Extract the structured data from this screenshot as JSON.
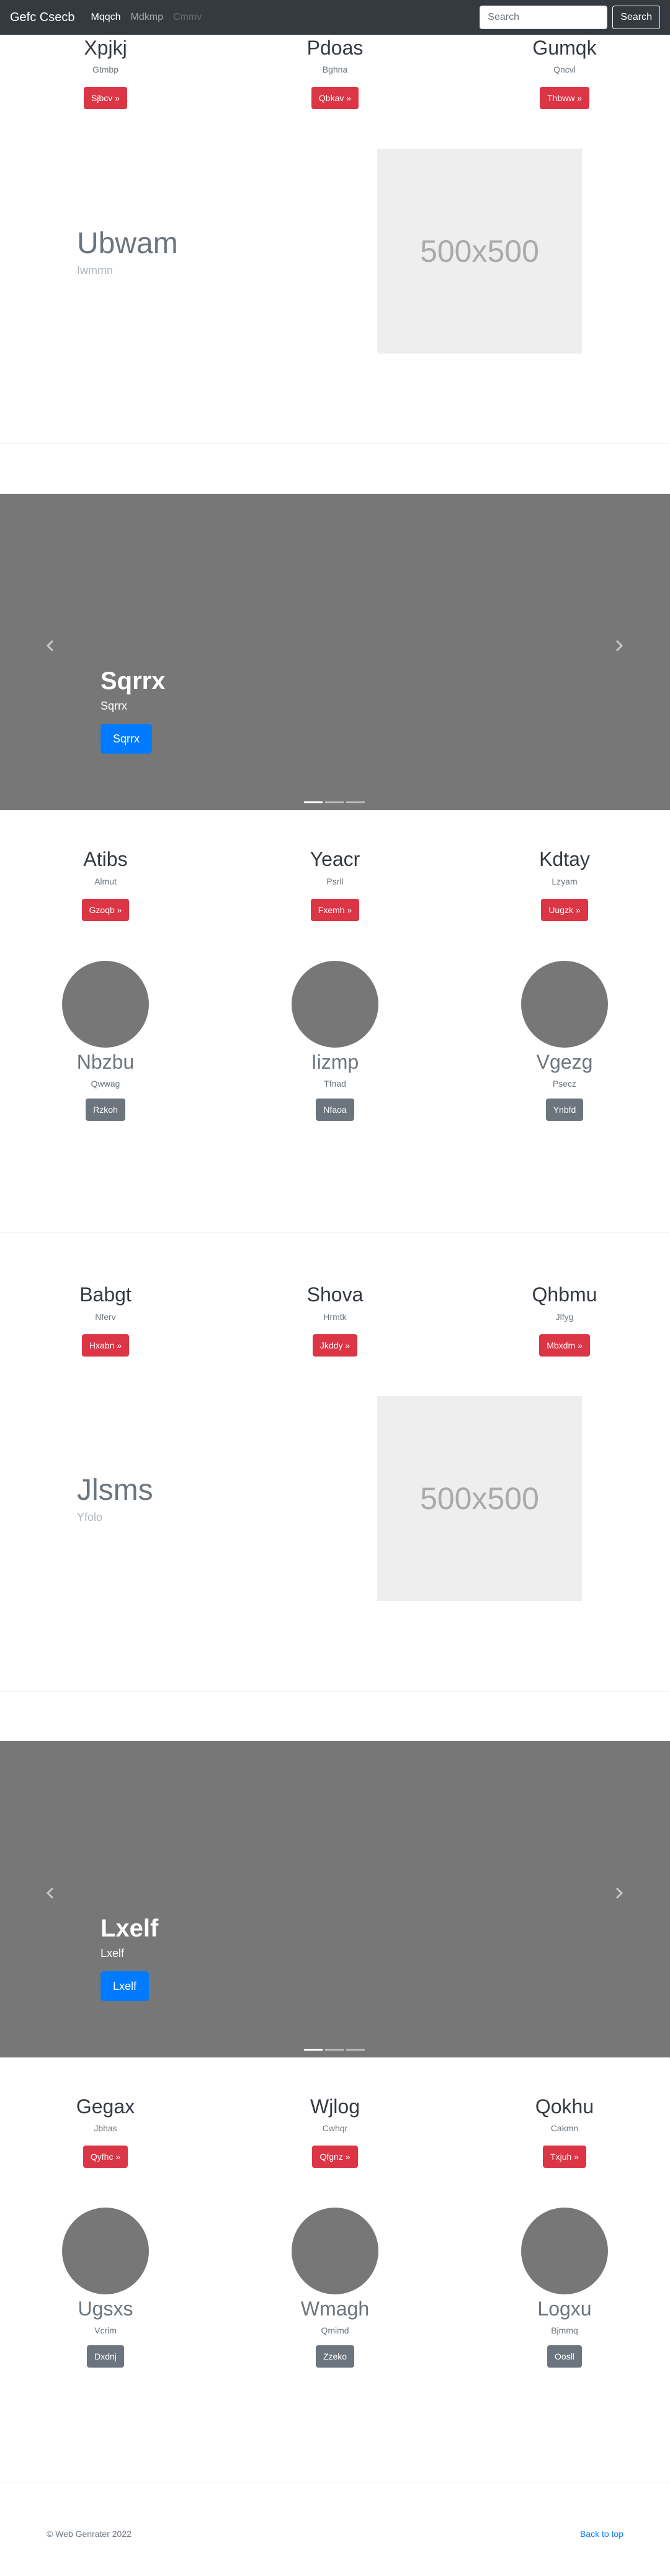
{
  "navbar": {
    "brand": "Gefc Csecb",
    "links": [
      "Mqqch",
      "Mdkmp",
      "Cmmv"
    ],
    "search_placeholder": "Search",
    "search_button": "Search"
  },
  "section1": {
    "columns": [
      {
        "title": "Xpjkj",
        "sub": "Gtmbp",
        "button": "Sjbcv »"
      },
      {
        "title": "Pdoas",
        "sub": "Bghna",
        "button": "Qbkav »"
      },
      {
        "title": "Gumqk",
        "sub": "Qncvl",
        "button": "Thbww »"
      }
    ],
    "feature": {
      "title": "Ubwam",
      "sub": "Iwmmn",
      "image": "500x500"
    }
  },
  "carousel1": {
    "title": "Sqrrx",
    "sub": "Sqrrx",
    "button": "Sqrrx"
  },
  "section2": {
    "columns": [
      {
        "title": "Atibs",
        "sub": "Almut",
        "button": "Gzoqb »"
      },
      {
        "title": "Yeacr",
        "sub": "Psrll",
        "button": "Fxemh »"
      },
      {
        "title": "Kdtay",
        "sub": "Lzyam",
        "button": "Uugzk »"
      }
    ],
    "circles": [
      {
        "title": "Nbzbu",
        "sub": "Qwwag",
        "button": "Rzkoh"
      },
      {
        "title": "Iizmp",
        "sub": "Tfnad",
        "button": "Nfaoa"
      },
      {
        "title": "Vgezg",
        "sub": "Psecz",
        "button": "Ynbfd"
      }
    ]
  },
  "section3": {
    "columns": [
      {
        "title": "Babgt",
        "sub": "Nferv",
        "button": "Hxabn »"
      },
      {
        "title": "Shova",
        "sub": "Hrmtk",
        "button": "Jkddy »"
      },
      {
        "title": "Qhbmu",
        "sub": "Jlfyg",
        "button": "Mbxdm »"
      }
    ],
    "feature": {
      "title": "Jlsms",
      "sub": "Yfolo",
      "image": "500x500"
    }
  },
  "carousel2": {
    "title": "Lxelf",
    "sub": "Lxelf",
    "button": "Lxelf"
  },
  "section4": {
    "columns": [
      {
        "title": "Gegax",
        "sub": "Jbhas",
        "button": "Qyfhc »"
      },
      {
        "title": "Wjlog",
        "sub": "Cwhqr",
        "button": "Qfgnz »"
      },
      {
        "title": "Qokhu",
        "sub": "Cakmn",
        "button": "Txjuh »"
      }
    ],
    "circles": [
      {
        "title": "Ugsxs",
        "sub": "Vcrim",
        "button": "Dxdnj"
      },
      {
        "title": "Wmagh",
        "sub": "Qmimd",
        "button": "Zzeko"
      },
      {
        "title": "Logxu",
        "sub": "Bjmmq",
        "button": "Oosll"
      }
    ]
  },
  "footer": {
    "copyright": "© Web Genrater 2022",
    "back_to_top": "Back to top"
  },
  "colors": {
    "navbar": "#343a40",
    "danger": "#dc3545",
    "primary": "#007bff",
    "secondary": "#6c757d",
    "carousel_bg": "#777777"
  },
  "carousel_active_slide": 1,
  "carousel_slide_count": 3
}
